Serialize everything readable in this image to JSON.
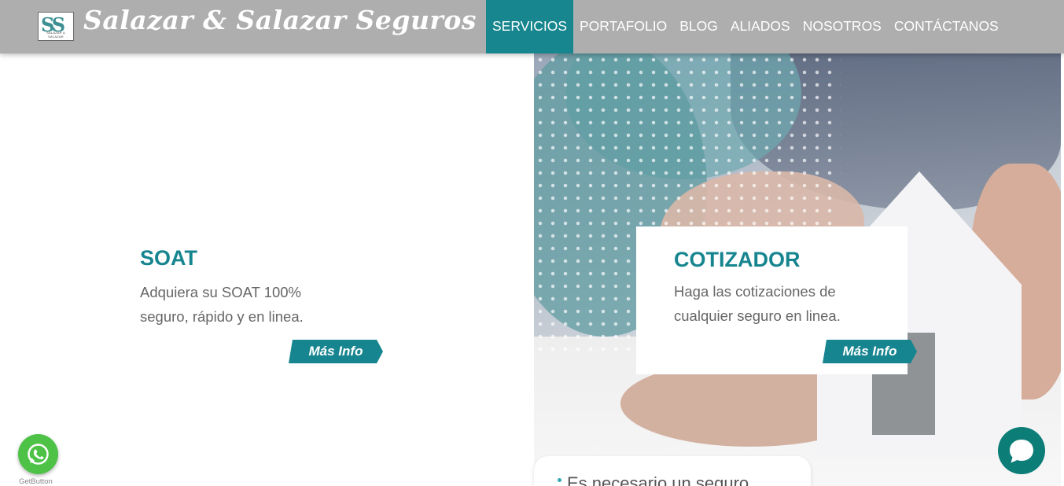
{
  "header": {
    "logo_text": "SALAZAR & SALAZAR",
    "logo_mark": "SS",
    "brand": "Salazar & Salazar Seguros",
    "nav": [
      {
        "label": "SERVICIOS",
        "active": true
      },
      {
        "label": "PORTAFOLIO",
        "active": false
      },
      {
        "label": "BLOG",
        "active": false
      },
      {
        "label": "ALIADOS",
        "active": false
      },
      {
        "label": "NOSOTROS",
        "active": false
      },
      {
        "label": "CONTÁCTANOS",
        "active": false
      }
    ]
  },
  "soat": {
    "title": "SOAT",
    "line1": "Adquiera su SOAT 100%",
    "line2": "seguro, rápido y en linea.",
    "button": "Más Info"
  },
  "cotizador": {
    "title": "COTIZADOR",
    "line1": "Haga las cotizaciones de",
    "line2": "cualquier seguro en linea.",
    "button": "Más Info"
  },
  "chat_bubble": {
    "text": "Es necesario un seguro"
  },
  "widgets": {
    "getbutton_label": "GetButton"
  },
  "colors": {
    "accent": "#16858f",
    "header": "#aeaeae",
    "whatsapp": "#4dc247",
    "chat": "#0d7d78"
  },
  "icons": [
    "whatsapp-icon",
    "chat-icon",
    "logo-icon"
  ]
}
